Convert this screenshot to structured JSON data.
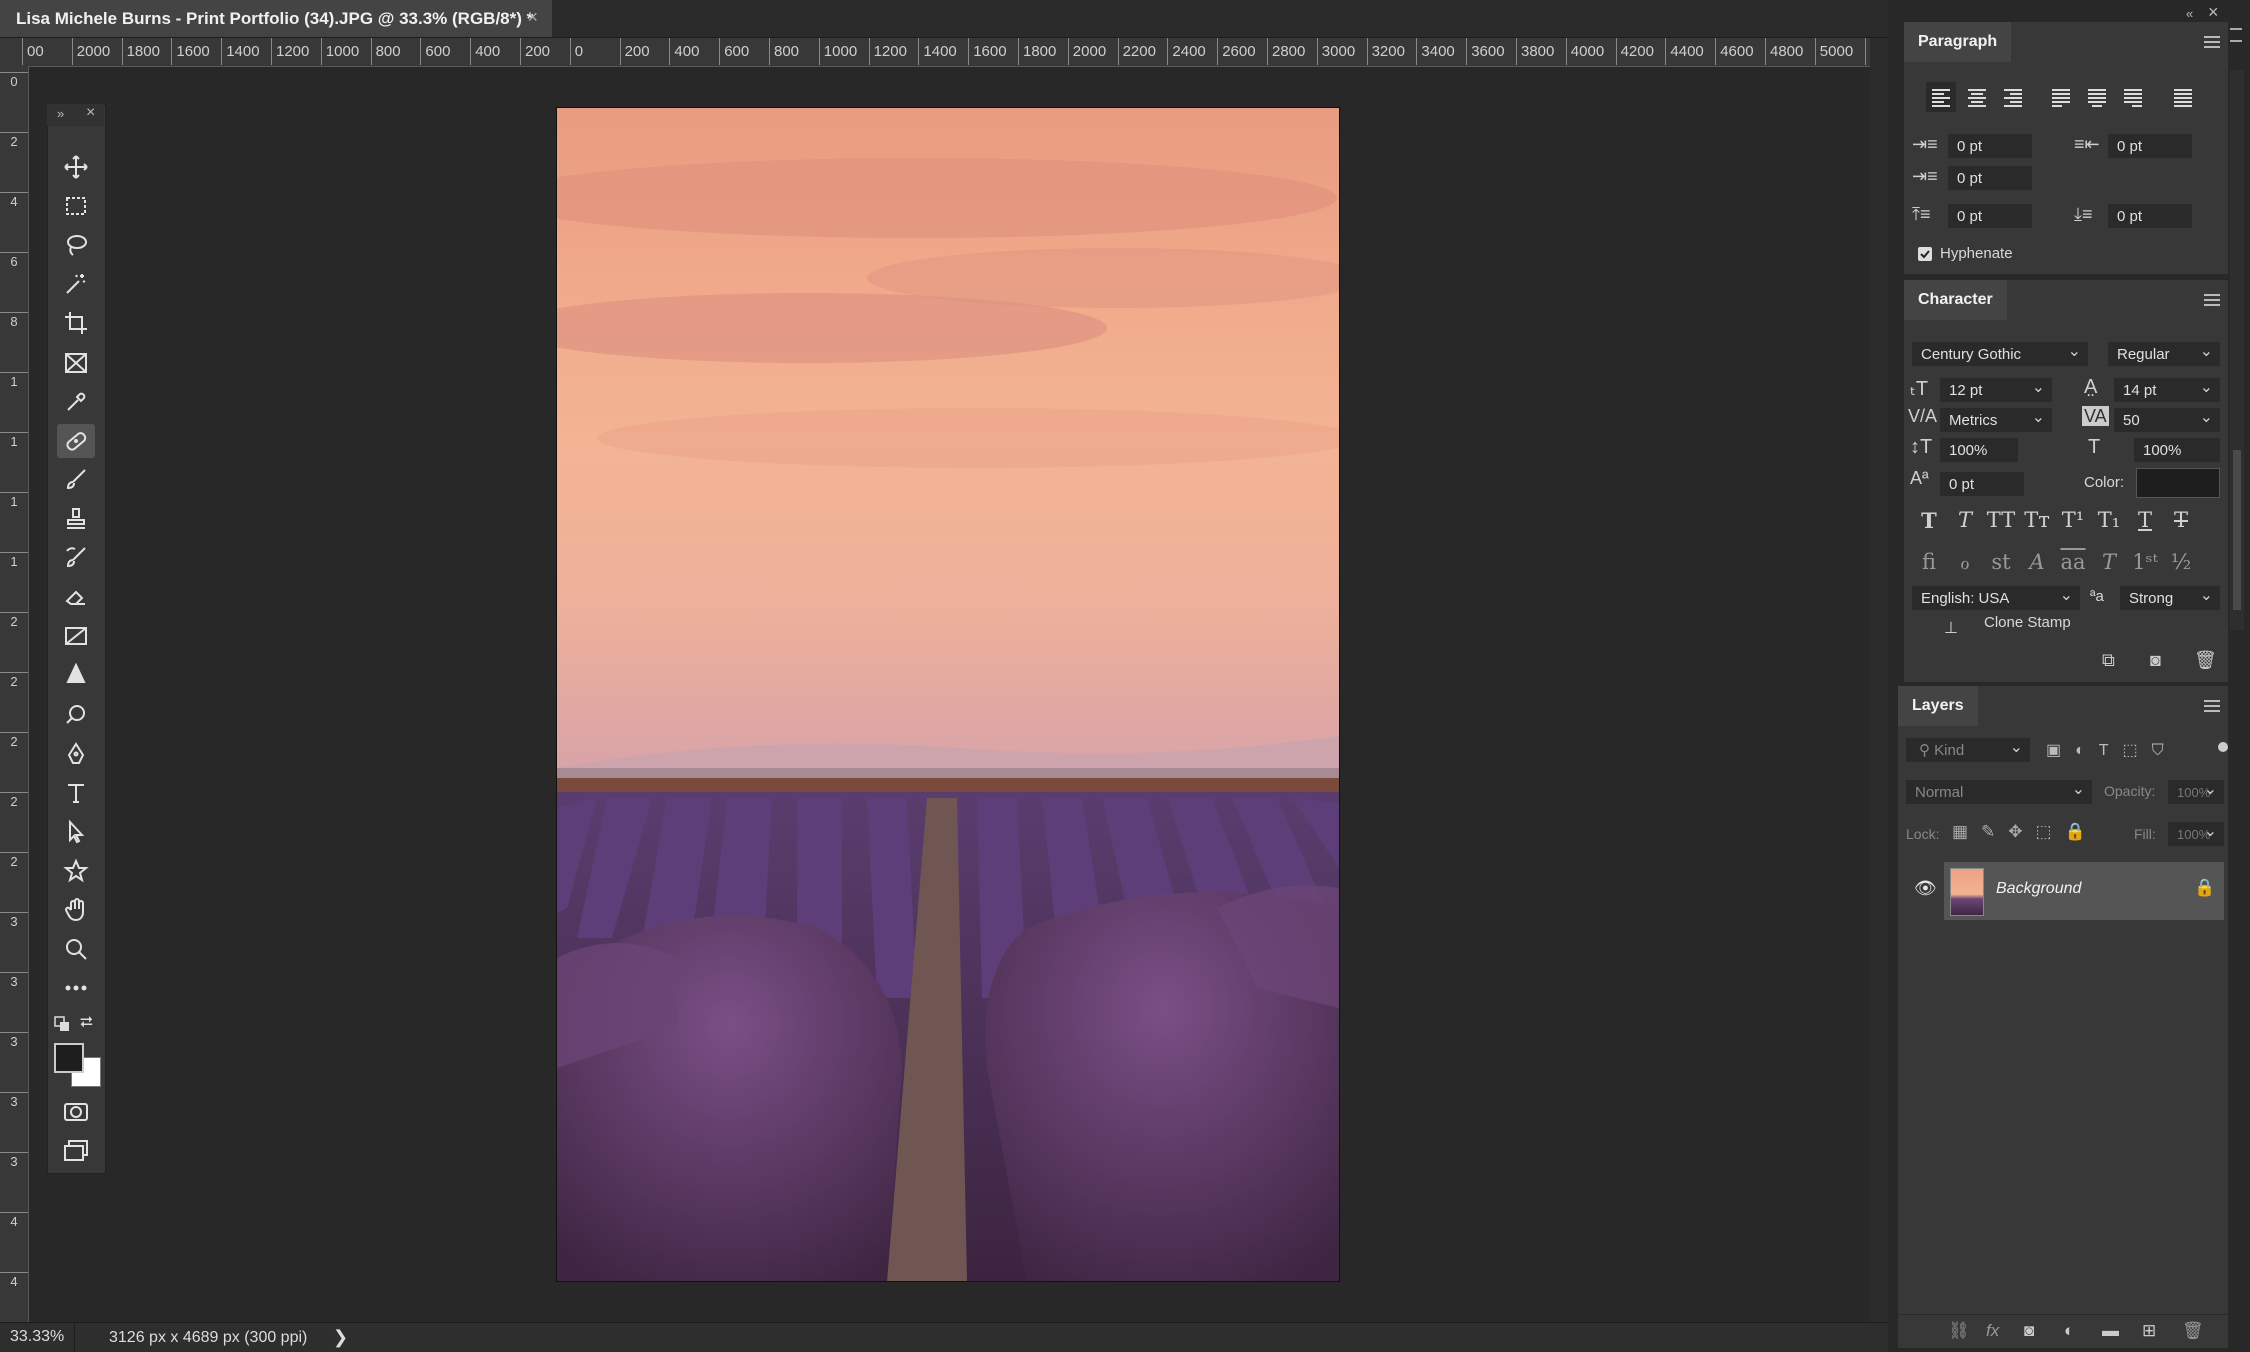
{
  "document": {
    "tab_title": "Lisa Michele Burns - Print Portfolio (34).JPG @ 33.3% (RGB/8*) *",
    "close_glyph": "×"
  },
  "rulers": {
    "top_ticks": [
      "00",
      "2000",
      "1800",
      "1600",
      "1400",
      "1200",
      "1000",
      "800",
      "600",
      "400",
      "200",
      "0",
      "200",
      "400",
      "600",
      "800",
      "1000",
      "1200",
      "1400",
      "1600",
      "1800",
      "2000",
      "2200",
      "2400",
      "2600",
      "2800",
      "3000",
      "3200",
      "3400",
      "3600",
      "3800",
      "4000",
      "4200",
      "4400",
      "4600",
      "4800",
      "5000",
      "5"
    ],
    "left_ticks": [
      "0",
      "2",
      "4",
      "6",
      "8",
      "1",
      "1",
      "1",
      "1",
      "2",
      "2",
      "2",
      "2",
      "2",
      "3",
      "3",
      "3",
      "3",
      "3",
      "4",
      "4"
    ]
  },
  "toolbar": {
    "tools": [
      "move-tool",
      "marquee-tool",
      "lasso-tool",
      "magic-wand-tool",
      "crop-tool",
      "frame-tool",
      "eyedropper-tool",
      "healing-brush-tool",
      "brush-tool",
      "clone-stamp-tool",
      "history-brush-tool",
      "eraser-tool",
      "gradient-tool",
      "blur-tool",
      "dodge-tool",
      "pen-tool",
      "type-tool",
      "path-selection-tool",
      "custom-shape-tool",
      "hand-tool",
      "zoom-tool",
      "more-tools"
    ],
    "active_tool": "healing-brush-tool"
  },
  "status": {
    "zoom": "33.33%",
    "dimensions": "3126 px x 4689 px (300 ppi)",
    "arrow": "❯"
  },
  "paragraph": {
    "tab": "Paragraph",
    "indent_left": "0 pt",
    "indent_right": "0 pt",
    "indent_first": "0 pt",
    "space_before": "0 pt",
    "space_after": "0 pt",
    "hyphenate_label": "Hyphenate",
    "hyphenate_checked": true
  },
  "character": {
    "tab": "Character",
    "font_family": "Century Gothic",
    "font_style": "Regular",
    "font_size": "12 pt",
    "leading": "14 pt",
    "kerning": "Metrics",
    "tracking": "50",
    "vertical_scale": "100%",
    "horizontal_scale": "100%",
    "baseline_shift": "0 pt",
    "color_label": "Color:",
    "color_value": "#1e1e1e",
    "language": "English: USA",
    "antialias": "Strong",
    "antialias_glyph": "ªa"
  },
  "history": {
    "item": "Clone Stamp"
  },
  "layers": {
    "tab": "Layers",
    "kind_placeholder": "Kind",
    "blend_mode": "Normal",
    "opacity_label": "Opacity:",
    "opacity_value": "100%",
    "lock_label": "Lock:",
    "fill_label": "Fill:",
    "fill_value": "100%",
    "layer_name": "Background"
  }
}
